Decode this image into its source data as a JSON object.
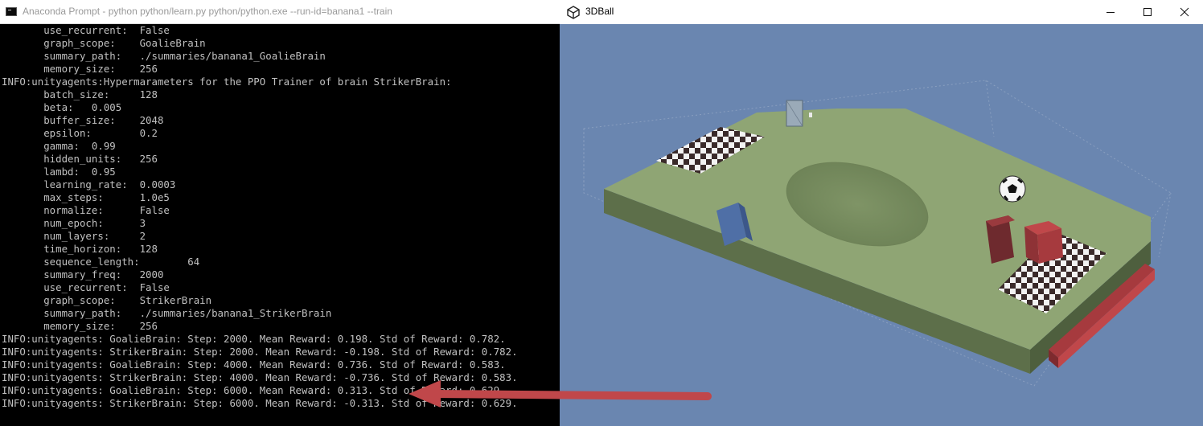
{
  "console": {
    "title": "Anaconda Prompt - python  python/learn.py python/python.exe --run-id=banana1 --train",
    "lines": [
      "       use_recurrent:  False",
      "       graph_scope:    GoalieBrain",
      "       summary_path:   ./summaries/banana1_GoalieBrain",
      "       memory_size:    256",
      "INFO:unityagents:Hypermarameters for the PPO Trainer of brain StrikerBrain:",
      "       batch_size:     128",
      "       beta:   0.005",
      "       buffer_size:    2048",
      "       epsilon:        0.2",
      "       gamma:  0.99",
      "       hidden_units:   256",
      "       lambd:  0.95",
      "       learning_rate:  0.0003",
      "       max_steps:      1.0e5",
      "       normalize:      False",
      "       num_epoch:      3",
      "       num_layers:     2",
      "       time_horizon:   128",
      "       sequence_length:        64",
      "       summary_freq:   2000",
      "       use_recurrent:  False",
      "       graph_scope:    StrikerBrain",
      "       summary_path:   ./summaries/banana1_StrikerBrain",
      "       memory_size:    256",
      "INFO:unityagents: GoalieBrain: Step: 2000. Mean Reward: 0.198. Std of Reward: 0.782.",
      "INFO:unityagents: StrikerBrain: Step: 2000. Mean Reward: -0.198. Std of Reward: 0.782.",
      "INFO:unityagents: GoalieBrain: Step: 4000. Mean Reward: 0.736. Std of Reward: 0.583.",
      "INFO:unityagents: StrikerBrain: Step: 4000. Mean Reward: -0.736. Std of Reward: 0.583.",
      "INFO:unityagents: GoalieBrain: Step: 6000. Mean Reward: 0.313. Std of Reward: 0.629.",
      "INFO:unityagents: StrikerBrain: Step: 6000. Mean Reward: -0.313. Std of Reward: 0.629."
    ]
  },
  "unity": {
    "title": "3DBall",
    "minimize_icon": "minimize-icon",
    "maximize_icon": "maximize-icon",
    "close_icon": "close-icon",
    "app_icon": "unity-logo-icon"
  },
  "colors": {
    "console_bg": "#000000",
    "console_text": "#c0c0c0",
    "sky": "#6a86b0",
    "field": "#8fa574",
    "arrow": "#c0474a"
  }
}
